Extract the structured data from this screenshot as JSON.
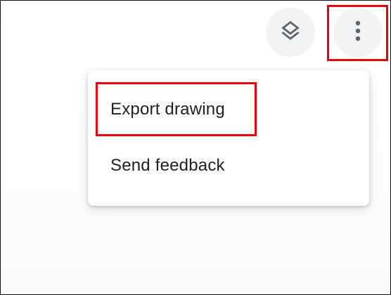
{
  "toolbar": {
    "layers_icon": "layers-icon",
    "more_icon": "more-vert-icon"
  },
  "menu": {
    "items": [
      {
        "label": "Export drawing"
      },
      {
        "label": "Send feedback"
      }
    ]
  },
  "colors": {
    "highlight": "#e8000b",
    "icon": "#5f6368",
    "text": "#202124",
    "button_bg": "#f1f3f4"
  }
}
